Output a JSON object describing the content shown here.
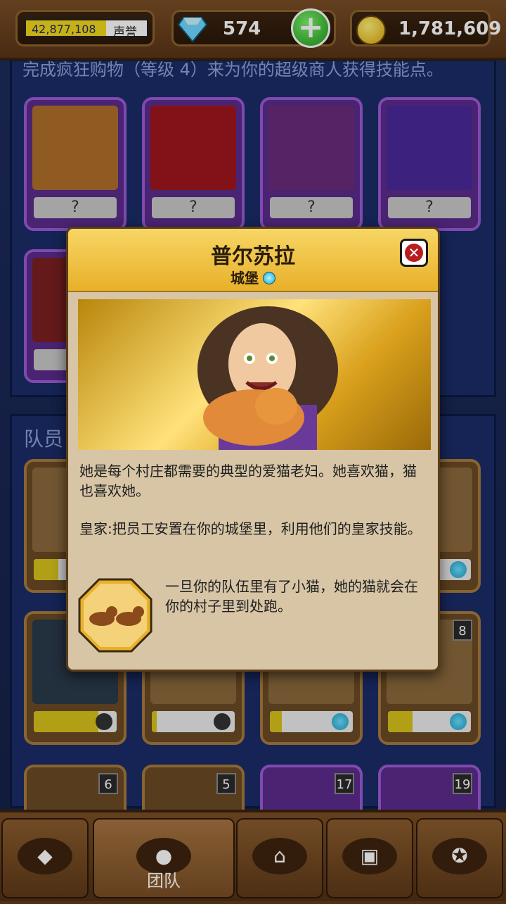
{
  "topbar": {
    "reputation_value": "42,877,108",
    "reputation_label": "声誉",
    "gems": "574",
    "coins": "1,781,609"
  },
  "background": {
    "hint_text": "完成疯狂购物（等级 4）来为你的超级商人获得技能点。",
    "locked_label": "?",
    "team_title": "队员",
    "levels": [
      "8",
      "6",
      "5",
      "17",
      "19"
    ]
  },
  "modal": {
    "title": "普尔苏拉",
    "subtitle": "城堡",
    "description": "她是每个村庄都需要的典型的爱猫老妇。她喜欢猫，猫也喜欢她。",
    "royal_text": "皇家:把员工安置在你的城堡里，利用他们的皇家技能。",
    "perk_text": "一旦你的队伍里有了小猫，她的猫就会在你的村子里到处跑。",
    "close_icon": "close-icon"
  },
  "nav": {
    "tabs": [
      {
        "icon": "gem-icon",
        "label": ""
      },
      {
        "icon": "team-icon",
        "label": "团队"
      },
      {
        "icon": "village-icon",
        "label": ""
      },
      {
        "icon": "chest-icon",
        "label": ""
      },
      {
        "icon": "medal-icon",
        "label": ""
      }
    ]
  },
  "colors": {
    "accent_gold": "#e8b02a",
    "modal_bg": "#d7c5a6",
    "panel_blue": "#1a2d68",
    "wood": "#7a4e26"
  }
}
